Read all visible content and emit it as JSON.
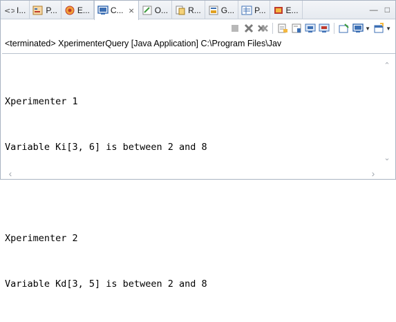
{
  "tabs": [
    {
      "label": "I...",
      "icon": "markers-icon"
    },
    {
      "label": "P...",
      "icon": "properties-icon"
    },
    {
      "label": "E...",
      "icon": "error-log-icon"
    },
    {
      "label": "C...",
      "icon": "console-icon",
      "active": true
    },
    {
      "label": "O...",
      "icon": "outline-icon"
    },
    {
      "label": "R...",
      "icon": "progress-icon"
    },
    {
      "label": "G...",
      "icon": "gradle-icon"
    },
    {
      "label": "P...",
      "icon": "problems-icon"
    },
    {
      "label": "E...",
      "icon": "editor-icon"
    }
  ],
  "status_line": "<terminated> XperimenterQuery [Java Application] C:\\Program Files\\Jav",
  "console_lines": [
    "Xperimenter 1",
    "Variable Ki[3, 6] is between 2 and 8",
    "",
    "Xperimenter 2",
    "Variable Kd[3, 5] is between 2 and 8"
  ],
  "colors": {
    "accent_blue": "#3c6fb4",
    "terminate_red": "#c0392b",
    "green": "#3a9a3a"
  }
}
